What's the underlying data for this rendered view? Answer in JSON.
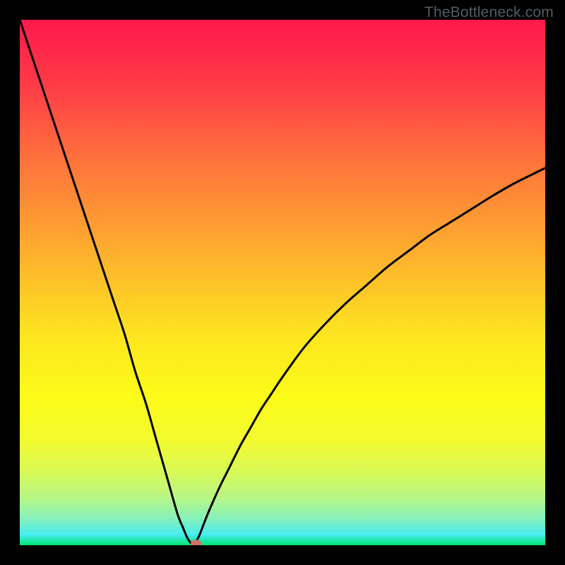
{
  "watermark": "TheBottleneck.com",
  "chart_data": {
    "type": "line",
    "title": "",
    "xlabel": "",
    "ylabel": "",
    "xlim": [
      0,
      100
    ],
    "ylim": [
      0,
      100
    ],
    "grid": false,
    "legend": false,
    "description": "Bottleneck-style V-curve over a vertical red-to-green gradient. The black curve starts near the top-left, descends to near zero around x≈33, then rises concavely toward the right edge reaching roughly y≈72 at x=100.",
    "series": [
      {
        "name": "bottleneck-curve",
        "x": [
          0,
          2,
          4,
          6,
          8,
          10,
          12,
          14,
          16,
          18,
          20,
          22,
          24,
          26,
          28,
          30,
          31,
          32,
          33,
          34,
          35,
          36,
          38,
          40,
          42,
          44,
          46,
          48,
          50,
          54,
          58,
          62,
          66,
          70,
          74,
          78,
          82,
          86,
          90,
          94,
          98,
          100
        ],
        "y": [
          100,
          94,
          88,
          82,
          76,
          70,
          64,
          58,
          52,
          46,
          40,
          33,
          27,
          20,
          13,
          6,
          3.5,
          1.2,
          0.2,
          1.5,
          4,
          6.5,
          11,
          15,
          19,
          22.5,
          26,
          29,
          32,
          37.5,
          42,
          46,
          49.5,
          53,
          56,
          59,
          61.5,
          64,
          66.5,
          68.8,
          70.8,
          71.8
        ]
      }
    ],
    "marker": {
      "x": 33.5,
      "y": 0.4,
      "color": "#cd7169"
    },
    "gradient_stops": [
      {
        "pct": 0,
        "color": "#ff194c"
      },
      {
        "pct": 12,
        "color": "#ff3a47"
      },
      {
        "pct": 28,
        "color": "#fe773b"
      },
      {
        "pct": 45,
        "color": "#fdb12d"
      },
      {
        "pct": 60,
        "color": "#fde51f"
      },
      {
        "pct": 72,
        "color": "#fcfb18"
      },
      {
        "pct": 80,
        "color": "#f2fb2e"
      },
      {
        "pct": 86,
        "color": "#d9f956"
      },
      {
        "pct": 91,
        "color": "#b7f685"
      },
      {
        "pct": 95,
        "color": "#84f1bb"
      },
      {
        "pct": 98,
        "color": "#47ecf3"
      },
      {
        "pct": 99,
        "color": "#21e9b0"
      },
      {
        "pct": 100,
        "color": "#04e670"
      }
    ]
  }
}
